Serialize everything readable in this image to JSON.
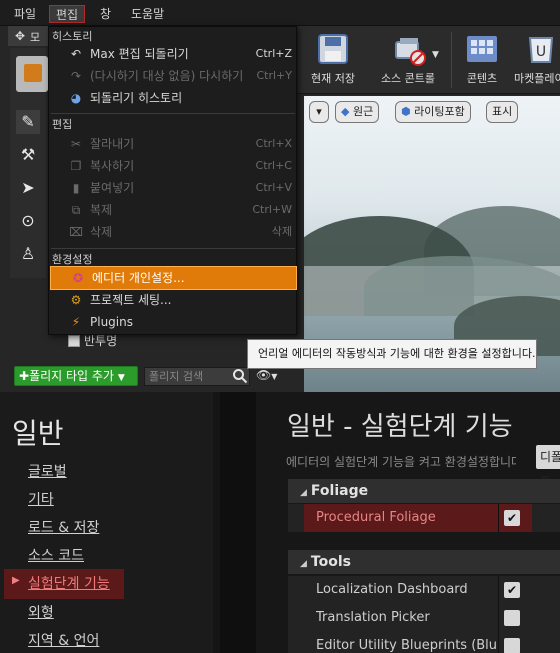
{
  "menubar": {
    "items": [
      "파일",
      "편집",
      "창",
      "도움말"
    ],
    "active": "편집"
  },
  "mode_tab": {
    "label": "모"
  },
  "toolbar": {
    "buttons": [
      {
        "label": "현재 저장",
        "icon": "save-icon"
      },
      {
        "label": "소스 콘트롤",
        "icon": "source-control-icon"
      },
      {
        "label": "콘텐츠",
        "icon": "content-icon"
      },
      {
        "label": "마켓플레이",
        "icon": "marketplace-icon"
      }
    ]
  },
  "viewport": {
    "buttons": [
      "▾",
      "원근",
      "라이팅포함",
      "표시"
    ]
  },
  "edit_menu": {
    "sections": [
      {
        "header": "히스토리",
        "items": [
          {
            "label": "Max 편집 되돌리기",
            "shortcut": "Ctrl+Z",
            "icon": "undo-icon",
            "enabled": true
          },
          {
            "label": "(다시하기 대상 없음) 다시하기",
            "shortcut": "Ctrl+Y",
            "icon": "redo-icon",
            "enabled": false
          },
          {
            "label": "되돌리기 히스토리",
            "shortcut": "",
            "icon": "history-icon",
            "enabled": true
          }
        ]
      },
      {
        "header": "편집",
        "items": [
          {
            "label": "잘라내기",
            "shortcut": "Ctrl+X",
            "icon": "cut-icon",
            "enabled": false
          },
          {
            "label": "복사하기",
            "shortcut": "Ctrl+C",
            "icon": "copy-icon",
            "enabled": false
          },
          {
            "label": "붙여넣기",
            "shortcut": "Ctrl+V",
            "icon": "paste-icon",
            "enabled": false
          },
          {
            "label": "복제",
            "shortcut": "Ctrl+W",
            "icon": "duplicate-icon",
            "enabled": false
          },
          {
            "label": "삭제",
            "shortcut": "삭제",
            "icon": "delete-icon",
            "enabled": false
          }
        ]
      },
      {
        "header": "환경설정",
        "items": [
          {
            "label": "에디터 개인설정...",
            "shortcut": "",
            "icon": "editor-preferences-icon",
            "enabled": true,
            "highlighted": true
          },
          {
            "label": "프로젝트 세팅...",
            "shortcut": "",
            "icon": "project-settings-icon",
            "enabled": true
          },
          {
            "label": "Plugins",
            "shortcut": "",
            "icon": "plugins-icon",
            "enabled": true
          }
        ]
      }
    ]
  },
  "tooltip": "언리얼 에디터의 작동방식과 기능에 대한 환경을 설정합니다.",
  "foliage": {
    "folder_label": "반투명",
    "add_button": "폴리지 타입 추가",
    "search_placeholder": "폴리지 검색"
  },
  "settings_nav": {
    "title": "일반",
    "items": [
      "글로벌",
      "기타",
      "로드 & 저장",
      "소스 코드",
      "실험단계 기능",
      "외형",
      "지역 & 언어"
    ],
    "selected": "실험단계 기능"
  },
  "settings_main": {
    "title": "일반 - 실험단계 기능",
    "subtitle": "에디터의 실험단계 기능을 켜고 환경설정합니다.",
    "default_button": "디폴트",
    "sections": [
      {
        "name": "Foliage",
        "rows": [
          {
            "label": "Procedural Foliage",
            "checked": true,
            "highlighted": true
          }
        ]
      },
      {
        "name": "Tools",
        "rows": [
          {
            "label": "Localization Dashboard",
            "checked": true,
            "highlighted": false
          },
          {
            "label": "Translation Picker",
            "checked": false,
            "highlighted": false
          },
          {
            "label": "Editor Utility Blueprints (Blutility)",
            "checked": false,
            "highlighted": false
          }
        ]
      }
    ]
  },
  "colors": {
    "menu_highlight": "#e07a09",
    "selected_nav": "#5b1919",
    "add_button": "#2b9c2b"
  }
}
